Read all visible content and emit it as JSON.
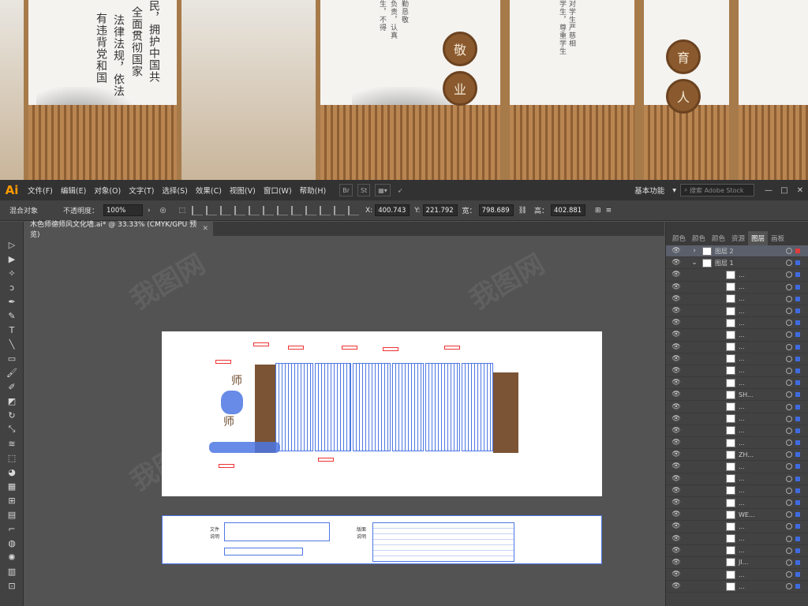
{
  "photo": {
    "texts": [
      {
        "text": "民，拥护中国共"
      },
      {
        "text": "全面贯彻国家"
      },
      {
        "text": "法律法规，依法"
      },
      {
        "text": "有违背党和国"
      },
      {
        "text": "勤恳敬"
      },
      {
        "text": "负责，认真"
      },
      {
        "text": "生，不得"
      },
      {
        "text": "学生，尊重学生"
      },
      {
        "text": "对学生严慈相"
      }
    ],
    "medals": [
      "敬",
      "业",
      "育",
      "人"
    ]
  },
  "app": {
    "logo": "Ai",
    "menu": [
      "文件(F)",
      "编辑(E)",
      "对象(O)",
      "文字(T)",
      "选择(S)",
      "效果(C)",
      "视图(V)",
      "窗口(W)",
      "帮助(H)"
    ],
    "bridge": [
      "Br",
      "St"
    ],
    "workspace": "基本功能",
    "search_placeholder": "搜索 Adobe Stock",
    "win_buttons": [
      "—",
      "□",
      "✕"
    ]
  },
  "control": {
    "object_type": "混合对象",
    "opacity_label": "不透明度：",
    "opacity_value": "100%",
    "x_label": "X:",
    "x_value": "400.743",
    "y_label": "Y:",
    "y_value": "221.792",
    "w_label": "宽：",
    "w_value": "798.689",
    "h_label": "高：",
    "h_value": "402.881"
  },
  "document": {
    "tab_title": "木色师德师风文化墙.ai* @ 33.33% (CMYK/GPU 预览)",
    "close": "✕"
  },
  "artboard2": {
    "label_left": "文件说明",
    "label_right": "版面说明"
  },
  "panel": {
    "tabs": [
      "颜色",
      "颜色",
      "颜色",
      "资源",
      "图层",
      "画板"
    ],
    "active_tab": "图层",
    "layers": [
      {
        "name": "图层 2",
        "top": true,
        "selected_color": "red"
      },
      {
        "name": "图层 1",
        "top": true,
        "selected_color": "blue"
      }
    ],
    "sublayers": [
      "...",
      "...",
      "...",
      "...",
      "...",
      "...",
      "...",
      "...",
      "...",
      "...",
      "SH...",
      "...",
      "...",
      "...",
      "...",
      "ZH...",
      "...",
      "...",
      "...",
      "...",
      "WE...",
      "...",
      "...",
      "...",
      "JI...",
      "...",
      "..."
    ]
  },
  "watermark": "我图网"
}
